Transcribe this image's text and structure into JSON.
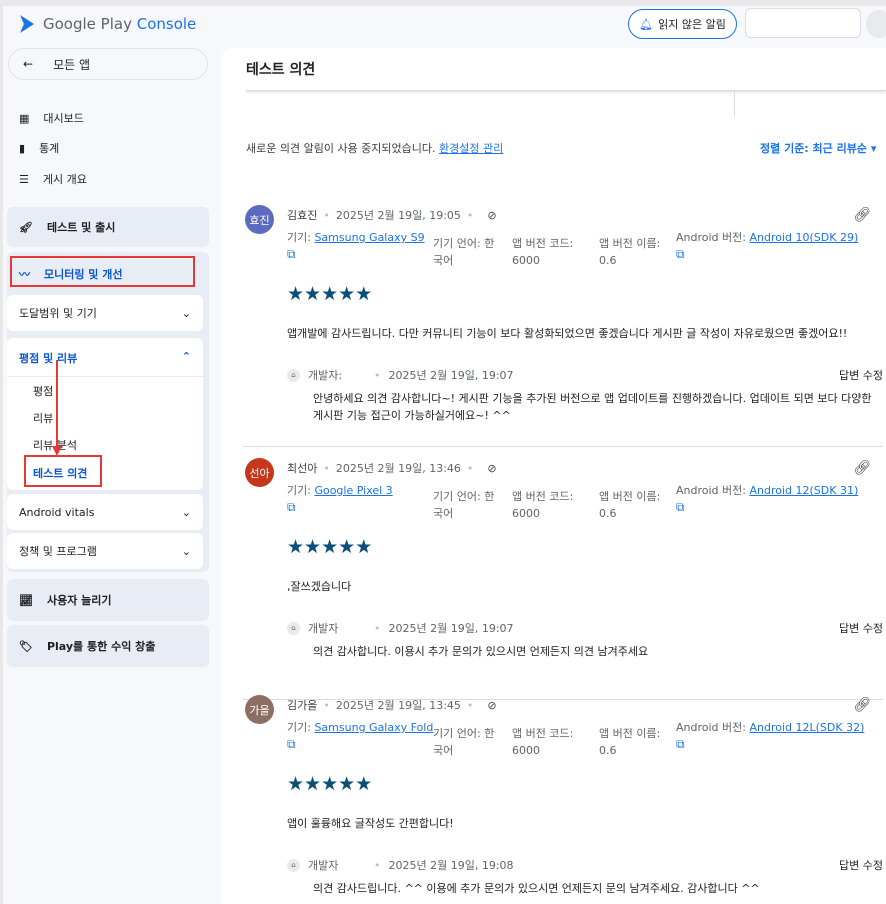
{
  "header": {
    "logo_google": "Google Play",
    "logo_console": "Console",
    "notifications_label": "읽지 않은 알림"
  },
  "sidebar": {
    "back_label": "모든 앱",
    "items": [
      {
        "label": "대시보드"
      },
      {
        "label": "통계"
      },
      {
        "label": "게시 개요"
      }
    ],
    "test_release": "테스트 및 출시",
    "monitoring": "모니터링 및 개선",
    "reach_devices": "도달범위 및 기기",
    "ratings_reviews": "평점 및 리뷰",
    "sub_items": [
      {
        "label": "평점"
      },
      {
        "label": "리뷰"
      },
      {
        "label": "리뷰 분석"
      },
      {
        "label": "테스트 의견"
      }
    ],
    "android_vitals": "Android vitals",
    "policy": "정책 및 프로그램",
    "grow_users": "사용자 늘리기",
    "monetize": "Play를 통한 수익 창출"
  },
  "main": {
    "title": "테스트 의견",
    "notice": "새로운 의견 알림이 사용 중지되었습니다.",
    "notice_link": "환경설정 관리",
    "sort_label": "정렬 기준: 최근 리뷰순",
    "labels": {
      "device": "기기:",
      "language": "기기 언어:",
      "code": "앱 버전 코드:",
      "vname": "앱 버전 이름:",
      "android": "Android 버전:",
      "edit": "답변 수정"
    },
    "reviews": [
      {
        "initials": "효진",
        "color": "#5c6bc0",
        "name": "김효진",
        "date": "2025년 2월 19일, 19:05",
        "device": "Samsung Galaxy S9",
        "language": "한국어",
        "code": "6000",
        "vname": "0.6",
        "android": "Android 10(SDK 29)",
        "rating": 5,
        "text": "앱개발에 감사드립니다. 다만 커뮤니티 기능이 보다 활성화되었으면 좋겠습니다 게시판 글 작성이 자유로웠으면 좋겠어요!!",
        "dev_label": "개발자:",
        "reply_date": "2025년 2월 19일, 19:07",
        "reply": "안녕하세요 의견 감사합니다~! 게시판 기능을 추가된 버전으로 앱 업데이트를 진행하겠습니다. 업데이트 되면 보다 다양한 게시판 기능 접근이 가능하실거에요~! ^^"
      },
      {
        "initials": "선아",
        "color": "#c5361b",
        "name": "최선아",
        "date": "2025년 2월 19일, 13:46",
        "device": "Google Pixel 3",
        "language": "한국어",
        "code": "6000",
        "vname": "0.6",
        "android": "Android 12(SDK 31)",
        "rating": 5,
        "text": ",잘쓰겠습니다",
        "dev_label": "개발자",
        "reply_date": "2025년 2월 19일, 19:07",
        "reply": "의견 감사합니다. 이용시 추가 문의가 있으시면 언제든지 의견 남겨주세요"
      },
      {
        "initials": "가을",
        "color": "#8d6e63",
        "name": "김가을",
        "date": "2025년 2월 19일, 13:45",
        "device": "Samsung Galaxy Fold",
        "language": "한국어",
        "code": "6000",
        "vname": "0.6",
        "android": "Android 12L(SDK 32)",
        "rating": 5,
        "text": "앱이 훌륭해요 글작성도 간편합니다!",
        "dev_label": "개발자",
        "reply_date": "2025년 2월 19일, 19:08",
        "reply": "의견 감사드립니다. ^^ 이용에 추가 문의가 있으시면 언제든지 문의 남겨주세요. 감사합니다 ^^"
      }
    ]
  },
  "colors": {
    "accent": "#1a73e8",
    "star": "#0b4f78",
    "annotation": "#e53935"
  }
}
